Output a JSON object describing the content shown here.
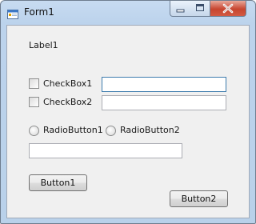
{
  "window": {
    "title": "Form1",
    "controls": {
      "minimize": "minimize",
      "maximize": "maximize",
      "close": "close"
    }
  },
  "form": {
    "label1": "Label1",
    "checkboxes": [
      {
        "label": "CheckBox1",
        "checked": false
      },
      {
        "label": "CheckBox2",
        "checked": false
      }
    ],
    "textbox1": {
      "value": "",
      "focused": true
    },
    "textbox2": {
      "value": ""
    },
    "radios": [
      {
        "label": "RadioButton1",
        "selected": false
      },
      {
        "label": "RadioButton2",
        "selected": false
      }
    ],
    "textbox3": {
      "value": ""
    },
    "button1": "Button1",
    "button2": "Button2"
  },
  "icons": [
    "app-form-icon",
    "minimize-icon",
    "maximize-icon",
    "close-icon"
  ]
}
